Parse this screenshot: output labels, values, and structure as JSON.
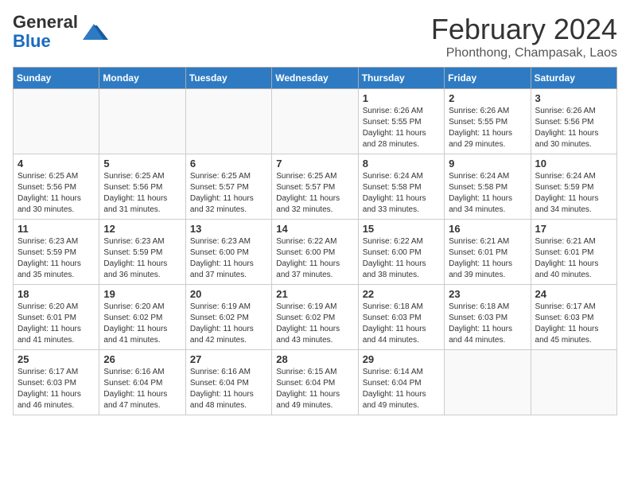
{
  "header": {
    "logo_general": "General",
    "logo_blue": "Blue",
    "month_title": "February 2024",
    "location": "Phonthong, Champasak, Laos"
  },
  "days_of_week": [
    "Sunday",
    "Monday",
    "Tuesday",
    "Wednesday",
    "Thursday",
    "Friday",
    "Saturday"
  ],
  "weeks": [
    [
      {
        "num": "",
        "info": ""
      },
      {
        "num": "",
        "info": ""
      },
      {
        "num": "",
        "info": ""
      },
      {
        "num": "",
        "info": ""
      },
      {
        "num": "1",
        "info": "Sunrise: 6:26 AM\nSunset: 5:55 PM\nDaylight: 11 hours and 28 minutes."
      },
      {
        "num": "2",
        "info": "Sunrise: 6:26 AM\nSunset: 5:55 PM\nDaylight: 11 hours and 29 minutes."
      },
      {
        "num": "3",
        "info": "Sunrise: 6:26 AM\nSunset: 5:56 PM\nDaylight: 11 hours and 30 minutes."
      }
    ],
    [
      {
        "num": "4",
        "info": "Sunrise: 6:25 AM\nSunset: 5:56 PM\nDaylight: 11 hours and 30 minutes."
      },
      {
        "num": "5",
        "info": "Sunrise: 6:25 AM\nSunset: 5:56 PM\nDaylight: 11 hours and 31 minutes."
      },
      {
        "num": "6",
        "info": "Sunrise: 6:25 AM\nSunset: 5:57 PM\nDaylight: 11 hours and 32 minutes."
      },
      {
        "num": "7",
        "info": "Sunrise: 6:25 AM\nSunset: 5:57 PM\nDaylight: 11 hours and 32 minutes."
      },
      {
        "num": "8",
        "info": "Sunrise: 6:24 AM\nSunset: 5:58 PM\nDaylight: 11 hours and 33 minutes."
      },
      {
        "num": "9",
        "info": "Sunrise: 6:24 AM\nSunset: 5:58 PM\nDaylight: 11 hours and 34 minutes."
      },
      {
        "num": "10",
        "info": "Sunrise: 6:24 AM\nSunset: 5:59 PM\nDaylight: 11 hours and 34 minutes."
      }
    ],
    [
      {
        "num": "11",
        "info": "Sunrise: 6:23 AM\nSunset: 5:59 PM\nDaylight: 11 hours and 35 minutes."
      },
      {
        "num": "12",
        "info": "Sunrise: 6:23 AM\nSunset: 5:59 PM\nDaylight: 11 hours and 36 minutes."
      },
      {
        "num": "13",
        "info": "Sunrise: 6:23 AM\nSunset: 6:00 PM\nDaylight: 11 hours and 37 minutes."
      },
      {
        "num": "14",
        "info": "Sunrise: 6:22 AM\nSunset: 6:00 PM\nDaylight: 11 hours and 37 minutes."
      },
      {
        "num": "15",
        "info": "Sunrise: 6:22 AM\nSunset: 6:00 PM\nDaylight: 11 hours and 38 minutes."
      },
      {
        "num": "16",
        "info": "Sunrise: 6:21 AM\nSunset: 6:01 PM\nDaylight: 11 hours and 39 minutes."
      },
      {
        "num": "17",
        "info": "Sunrise: 6:21 AM\nSunset: 6:01 PM\nDaylight: 11 hours and 40 minutes."
      }
    ],
    [
      {
        "num": "18",
        "info": "Sunrise: 6:20 AM\nSunset: 6:01 PM\nDaylight: 11 hours and 41 minutes."
      },
      {
        "num": "19",
        "info": "Sunrise: 6:20 AM\nSunset: 6:02 PM\nDaylight: 11 hours and 41 minutes."
      },
      {
        "num": "20",
        "info": "Sunrise: 6:19 AM\nSunset: 6:02 PM\nDaylight: 11 hours and 42 minutes."
      },
      {
        "num": "21",
        "info": "Sunrise: 6:19 AM\nSunset: 6:02 PM\nDaylight: 11 hours and 43 minutes."
      },
      {
        "num": "22",
        "info": "Sunrise: 6:18 AM\nSunset: 6:03 PM\nDaylight: 11 hours and 44 minutes."
      },
      {
        "num": "23",
        "info": "Sunrise: 6:18 AM\nSunset: 6:03 PM\nDaylight: 11 hours and 44 minutes."
      },
      {
        "num": "24",
        "info": "Sunrise: 6:17 AM\nSunset: 6:03 PM\nDaylight: 11 hours and 45 minutes."
      }
    ],
    [
      {
        "num": "25",
        "info": "Sunrise: 6:17 AM\nSunset: 6:03 PM\nDaylight: 11 hours and 46 minutes."
      },
      {
        "num": "26",
        "info": "Sunrise: 6:16 AM\nSunset: 6:04 PM\nDaylight: 11 hours and 47 minutes."
      },
      {
        "num": "27",
        "info": "Sunrise: 6:16 AM\nSunset: 6:04 PM\nDaylight: 11 hours and 48 minutes."
      },
      {
        "num": "28",
        "info": "Sunrise: 6:15 AM\nSunset: 6:04 PM\nDaylight: 11 hours and 49 minutes."
      },
      {
        "num": "29",
        "info": "Sunrise: 6:14 AM\nSunset: 6:04 PM\nDaylight: 11 hours and 49 minutes."
      },
      {
        "num": "",
        "info": ""
      },
      {
        "num": "",
        "info": ""
      }
    ]
  ]
}
